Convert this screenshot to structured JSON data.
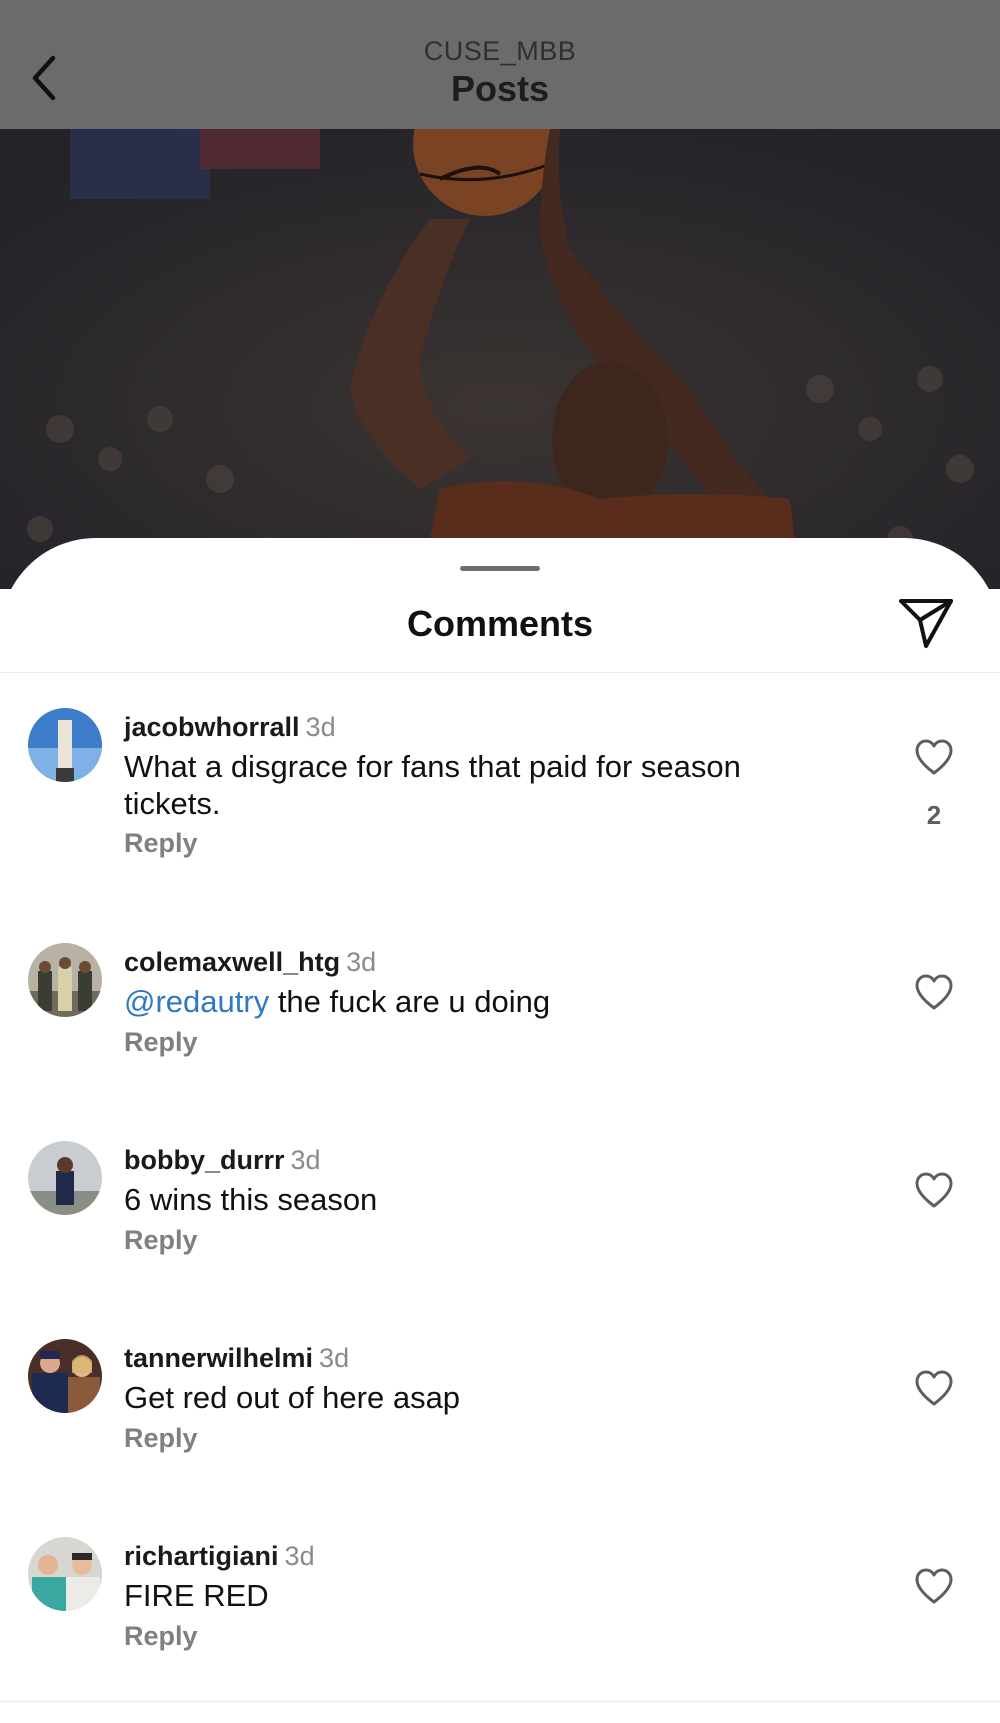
{
  "nav": {
    "account": "CUSE_MBB",
    "title": "Posts",
    "back_icon": "chevron-left-icon"
  },
  "post": {
    "image_subject": "basketball player shooting"
  },
  "sheet": {
    "title": "Comments",
    "share_icon": "paper-plane-icon"
  },
  "comments": [
    {
      "username": "jacobwhorrall",
      "time": "3d",
      "text": "What a disgrace for fans that paid for season tickets.",
      "reply_label": "Reply",
      "likes": "2"
    },
    {
      "username": "colemaxwell_htg",
      "time": "3d",
      "mention": "@redautry",
      "text": " the fuck are u doing",
      "reply_label": "Reply"
    },
    {
      "username": "bobby_durrr",
      "time": "3d",
      "text": "6 wins this season",
      "reply_label": "Reply"
    },
    {
      "username": "tannerwilhelmi",
      "time": "3d",
      "text": "Get red out of here asap",
      "reply_label": "Reply"
    },
    {
      "username": "richartigiani",
      "time": "3d",
      "text": "FIRE RED",
      "reply_label": "Reply"
    }
  ],
  "colors": {
    "nav_background": "#6b6b6d",
    "mention": "#2f78c4",
    "secondary_text": "#8a8a8e"
  }
}
